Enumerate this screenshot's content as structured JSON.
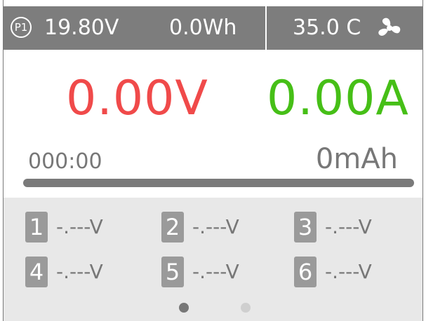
{
  "top_bar": {
    "profile": "P1",
    "input_voltage": "19.80V",
    "energy": "0.0Wh",
    "temperature": "35.0 C",
    "fan_icon": "fan-icon"
  },
  "readings": {
    "voltage": "0.00V",
    "current": "0.00A",
    "elapsed_time": "000:00",
    "capacity": "0mAh",
    "progress_percent": 100
  },
  "cells": [
    {
      "index": "1",
      "value": "-.---V"
    },
    {
      "index": "2",
      "value": "-.---V"
    },
    {
      "index": "3",
      "value": "-.---V"
    },
    {
      "index": "4",
      "value": "-.---V"
    },
    {
      "index": "5",
      "value": "-.---V"
    },
    {
      "index": "6",
      "value": "-.---V"
    }
  ],
  "pager": {
    "active_page": 1,
    "total_pages": 2
  },
  "colors": {
    "voltage": "#f04a4a",
    "current": "#46bf17",
    "bar_bg": "#7d7d7d",
    "cell_panel_bg": "#e8e8e8",
    "dot_active": "#777777",
    "dot_inactive": "#cfcfcf"
  }
}
